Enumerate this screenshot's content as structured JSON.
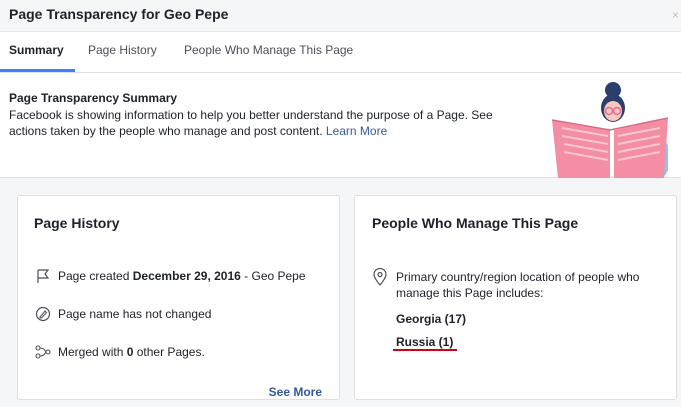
{
  "window": {
    "title": "Page Transparency for Geo Pepe",
    "close_glyph": "×"
  },
  "tabs": [
    {
      "label": "Summary",
      "active": true
    },
    {
      "label": "Page History",
      "active": false
    },
    {
      "label": "People Who Manage This Page",
      "active": false
    }
  ],
  "summary": {
    "heading": "Page Transparency Summary",
    "description": "Facebook is showing information to help you better understand the purpose of a Page. See actions taken by the people who manage and post content.",
    "learn_more": "Learn More"
  },
  "page_history": {
    "title": "Page History",
    "created_prefix": "Page created",
    "created_date": "December 29, 2016",
    "created_suffix": "- Geo Pepe",
    "name_changed": "Page name has not changed",
    "merged_prefix": "Merged with",
    "merged_count": "0",
    "merged_suffix": "other Pages.",
    "see_more": "See More"
  },
  "managers": {
    "title": "People Who Manage This Page",
    "location_text": "Primary country/region location of people who manage this Page includes:",
    "countries": [
      "Georgia (17)",
      "Russia (1)"
    ],
    "highlight_color": "#d0021b"
  },
  "colors": {
    "accent": "#4080ff",
    "link": "#365899"
  }
}
